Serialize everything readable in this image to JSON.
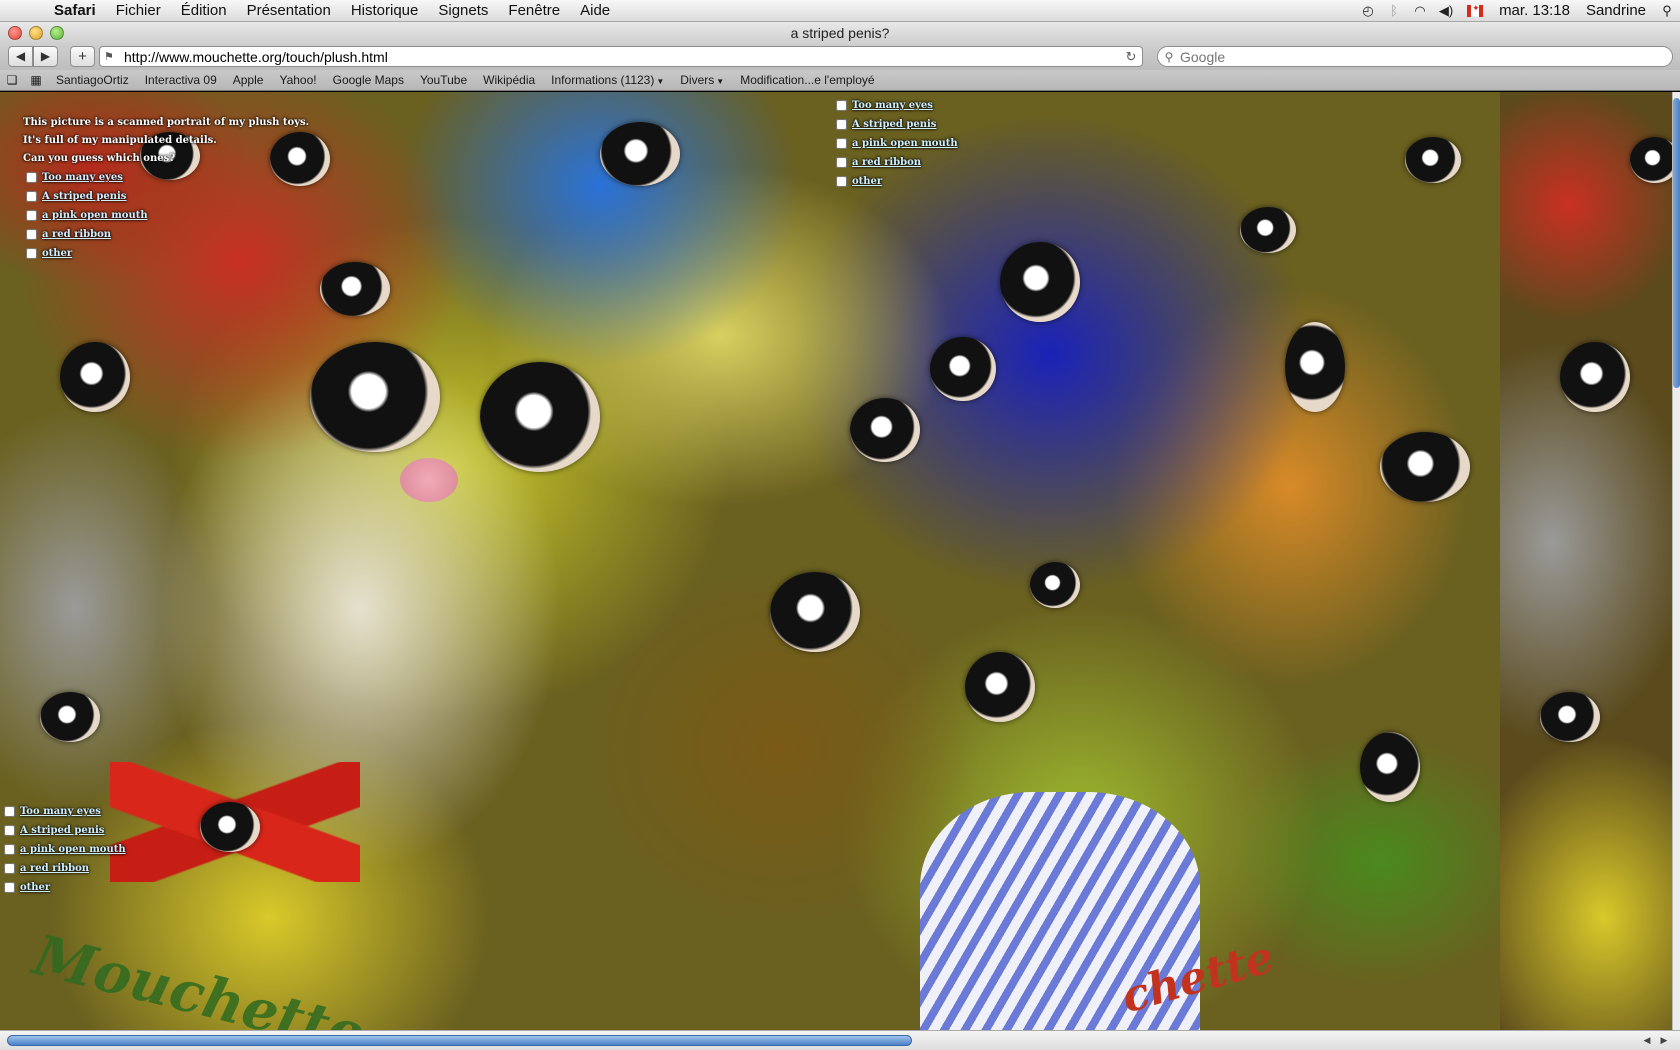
{
  "menubar": {
    "app_name": "Safari",
    "items": [
      "Fichier",
      "Édition",
      "Présentation",
      "Historique",
      "Signets",
      "Fenêtre",
      "Aide"
    ],
    "clock": "mar. 13:18",
    "user": "Sandrine",
    "flag_label": "CSA"
  },
  "window": {
    "title": "a striped penis?"
  },
  "toolbar": {
    "back": "◀",
    "forward": "▶",
    "add_bookmark": "+",
    "url": "http://www.mouchette.org/touch/plush.html",
    "search_placeholder": "Google"
  },
  "bookmarks": {
    "items": [
      {
        "label": "SantiagoOrtiz",
        "menu": false
      },
      {
        "label": "Interactiva 09",
        "menu": false
      },
      {
        "label": "Apple",
        "menu": false
      },
      {
        "label": "Yahoo!",
        "menu": false
      },
      {
        "label": "Google Maps",
        "menu": false
      },
      {
        "label": "YouTube",
        "menu": false
      },
      {
        "label": "Wikipédia",
        "menu": false
      },
      {
        "label": "Informations (1123)",
        "menu": true
      },
      {
        "label": "Divers",
        "menu": true
      },
      {
        "label": "Modification...e l'employé",
        "menu": false
      }
    ]
  },
  "page": {
    "intro_line1": "This picture is a scanned portrait of my plush toys.",
    "intro_line2": "It's full of my manipulated details.",
    "intro_line3": "Can you guess which ones?",
    "options": [
      "Too many eyes",
      "A striped penis",
      "a pink open mouth",
      "a red ribbon",
      "other"
    ],
    "watermark": "Mouchette",
    "watermark2": "chette"
  }
}
